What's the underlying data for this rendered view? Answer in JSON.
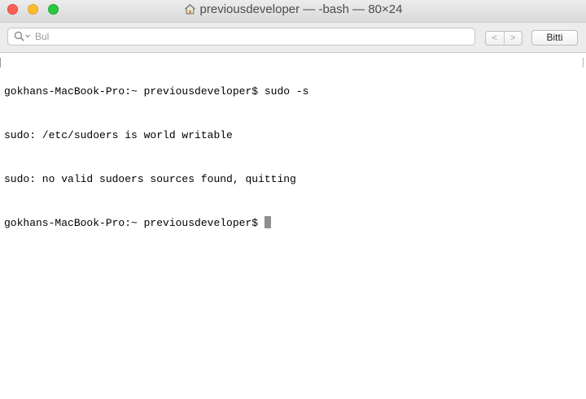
{
  "window": {
    "title": "previousdeveloper — -bash — 80×24",
    "icon": "home-icon"
  },
  "findbar": {
    "search_placeholder": "Bul",
    "search_value": "",
    "prev_glyph": "<",
    "next_glyph": ">",
    "done_label": "Bitti"
  },
  "terminal": {
    "lines": [
      "gokhans-MacBook-Pro:~ previousdeveloper$ sudo -s",
      "sudo: /etc/sudoers is world writable",
      "sudo: no valid sudoers sources found, quitting",
      "gokhans-MacBook-Pro:~ previousdeveloper$"
    ]
  },
  "colors": {
    "close": "#fc5f57",
    "minimize": "#fdbc2e",
    "maximize": "#28c840"
  }
}
